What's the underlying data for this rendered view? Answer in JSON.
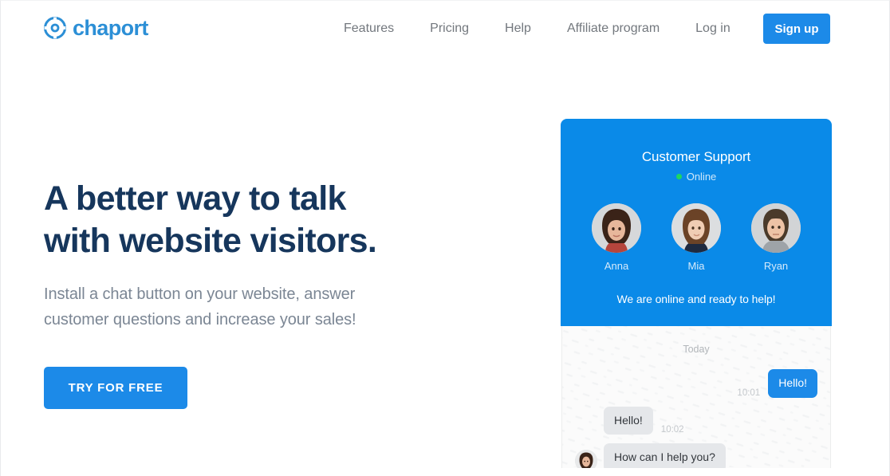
{
  "brand": {
    "name": "chaport",
    "logo_icon": "lifebuoy-icon",
    "logo_color": "#2c8fd6",
    "accent_color": "#1c8ae8",
    "widget_header_color": "#0a8ae8"
  },
  "nav": {
    "links": [
      {
        "label": "Features",
        "name": "nav-link-features"
      },
      {
        "label": "Pricing",
        "name": "nav-link-pricing"
      },
      {
        "label": "Help",
        "name": "nav-link-help"
      },
      {
        "label": "Affiliate program",
        "name": "nav-link-affiliate-program"
      },
      {
        "label": "Log in",
        "name": "nav-link-log-in"
      }
    ],
    "signup_label": "Sign up"
  },
  "hero": {
    "title_line1": "A better way to talk",
    "title_line2": "with website visitors.",
    "title_color": "#16365c",
    "subtitle_line1": "Install a chat button on your website, answer",
    "subtitle_line2": "customer questions and increase your sales!",
    "subtitle_color": "#7b8694",
    "cta_label": "TRY FOR FREE"
  },
  "widget": {
    "title": "Customer Support",
    "status_label": "Online",
    "status_color": "#1ed760",
    "tagline": "We are online and ready to help!",
    "operators": [
      {
        "name": "Anna",
        "avatar": "avatar-anna"
      },
      {
        "name": "Mia",
        "avatar": "avatar-mia"
      },
      {
        "name": "Ryan",
        "avatar": "avatar-ryan"
      }
    ],
    "chat": {
      "day_divider": "Today",
      "messages": [
        {
          "direction": "out",
          "text": "Hello!",
          "time": "10:01",
          "avatar": ""
        },
        {
          "direction": "in",
          "text": "Hello!",
          "time": "10:02",
          "avatar": ""
        },
        {
          "direction": "in",
          "text": "How can I help you?",
          "time": "",
          "avatar": "avatar-anna-small"
        }
      ]
    }
  }
}
